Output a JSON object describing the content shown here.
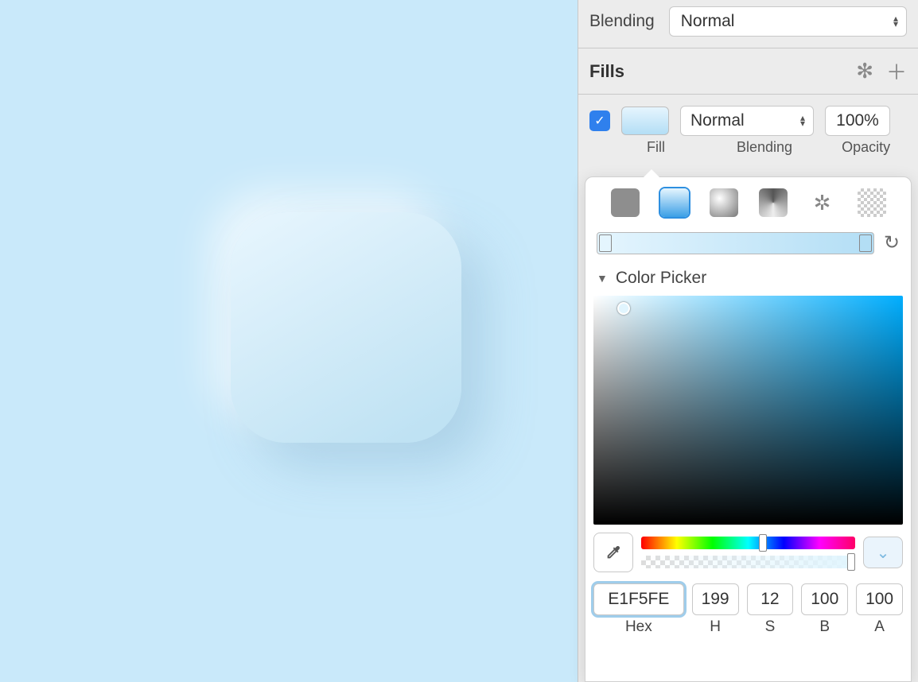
{
  "canvas": {
    "background": "#C9E9FA",
    "shape_fill_start": "#E8F6FE",
    "shape_fill_end": "#BFE2F3"
  },
  "inspector": {
    "blending_label": "Blending",
    "blending_value": "Normal",
    "fills": {
      "title": "Fills",
      "entry": {
        "checked": true,
        "blend": "Normal",
        "opacity": "100%"
      },
      "sublabels": {
        "fill": "Fill",
        "blending": "Blending",
        "opacity": "Opacity"
      }
    }
  },
  "popover": {
    "fill_types": [
      "solid",
      "linear",
      "radial",
      "angular",
      "image",
      "noise"
    ],
    "active_type": "linear",
    "color_picker_title": "Color Picker",
    "values": {
      "hex": "E1F5FE",
      "h": "199",
      "s": "12",
      "b": "100",
      "a": "100"
    },
    "value_labels": {
      "hex": "Hex",
      "h": "H",
      "s": "S",
      "b": "B",
      "a": "A"
    }
  }
}
